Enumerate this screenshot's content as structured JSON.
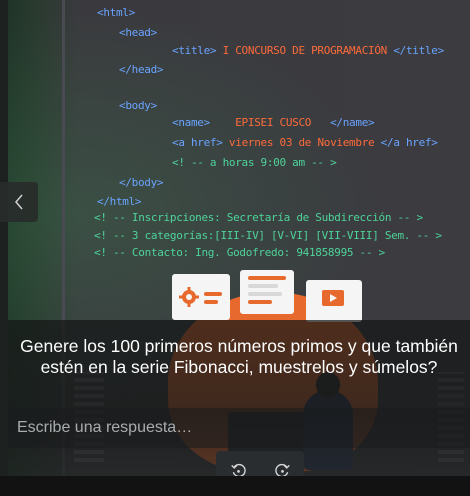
{
  "poster": {
    "code_lines": [
      "<html>",
      "<head>",
      "<title>",
      "I CONCURSO DE PROGRAMACIÓN",
      "</title>",
      "</head>",
      "<body>",
      "<name>",
      "EPISEI CUSCO",
      "</name>",
      "<a href>",
      "viernes 03 de Noviembre",
      "</a href>",
      "<! -- a horas 9:00 am -- >",
      "</body>",
      "</html>",
      "<! -- Inscripciones: Secretaría de Subdirección -- >",
      "<! -- 3 categorías:[III-IV] [V-VI] [VII-VIII] Sem. -- >",
      "<! -- Contacto: Ing. Godofredo: 941858995 -- >"
    ]
  },
  "question": {
    "text": "Genere los 100 primeros números primos y que también estén en la serie Fibonacci, muestrelos y súmelos?"
  },
  "answer": {
    "placeholder": "Escribe una respuesta…"
  },
  "navigation": {
    "prev_icon": "chevron-left-icon"
  },
  "controls": {
    "rotate_left_icon": "rotate-left-icon",
    "rotate_right_icon": "rotate-right-icon"
  },
  "colors": {
    "tag": "#6aa4ff",
    "comment": "#4ed39a",
    "highlight": "#ff6a3a"
  }
}
